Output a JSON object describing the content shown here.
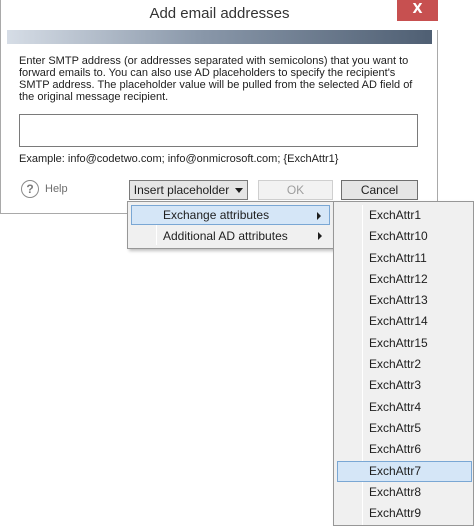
{
  "dialog": {
    "title": "Add email addresses",
    "close_label": "X",
    "description": "Enter SMTP address (or addresses separated with semicolons) that you want to forward emails to. You can also use AD placeholders to specify the recipient's SMTP address. The placeholder value will be pulled from the selected AD field of the original message recipient.",
    "input_value": "",
    "example": "Example: info@codetwo.com; info@onmicrosoft.com; {ExchAttr1}",
    "help_label": "Help",
    "help_glyph": "?",
    "insert_label": "Insert placeholder",
    "ok_label": "OK",
    "cancel_label": "Cancel"
  },
  "placeholder_menu": {
    "items": [
      {
        "label": "Exchange attributes"
      },
      {
        "label": "Additional AD attributes"
      }
    ],
    "highlighted": "Exchange attributes"
  },
  "exchange_submenu": {
    "items": [
      "ExchAttr1",
      "ExchAttr10",
      "ExchAttr11",
      "ExchAttr12",
      "ExchAttr13",
      "ExchAttr14",
      "ExchAttr15",
      "ExchAttr2",
      "ExchAttr3",
      "ExchAttr4",
      "ExchAttr5",
      "ExchAttr6",
      "ExchAttr7",
      "ExchAttr8",
      "ExchAttr9"
    ],
    "highlighted": "ExchAttr7"
  },
  "colors": {
    "close_button": "#c75050",
    "highlight_bg": "#d5e6f7",
    "highlight_border": "#7aa7d4"
  },
  "icons": [
    "close-icon",
    "help-icon",
    "dropdown-caret-icon",
    "submenu-arrow-icon"
  ]
}
